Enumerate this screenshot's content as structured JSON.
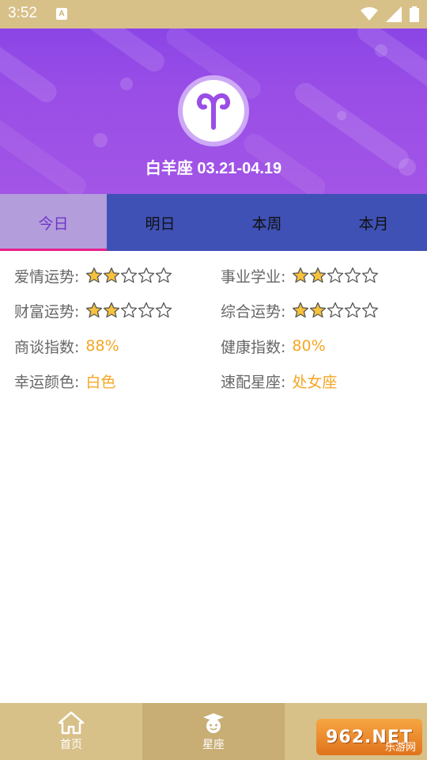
{
  "status_bar": {
    "time": "3:52",
    "a_badge": "A"
  },
  "header": {
    "sign_title": "白羊座 03.21-04.19"
  },
  "tabs": [
    {
      "label": "今日",
      "active": true
    },
    {
      "label": "明日",
      "active": false
    },
    {
      "label": "本周",
      "active": false
    },
    {
      "label": "本月",
      "active": false
    }
  ],
  "fortune": {
    "love": {
      "label": "爱情运势:",
      "stars_filled": 2,
      "stars_total": 5
    },
    "career": {
      "label": "事业学业:",
      "stars_filled": 2,
      "stars_total": 5
    },
    "wealth": {
      "label": "财富运势:",
      "stars_filled": 2,
      "stars_total": 5
    },
    "overall": {
      "label": "综合运势:",
      "stars_filled": 2,
      "stars_total": 5
    },
    "negotiation": {
      "label": "商谈指数:",
      "value": "88%"
    },
    "health": {
      "label": "健康指数:",
      "value": "80%"
    },
    "lucky_color": {
      "label": "幸运颜色:",
      "value": "白色"
    },
    "match_sign": {
      "label": "速配星座:",
      "value": "处女座"
    }
  },
  "bottom_nav": [
    {
      "label": "首页",
      "icon": "home-icon",
      "active": false
    },
    {
      "label": "星座",
      "icon": "scholar-avatar-icon",
      "active": true
    }
  ],
  "watermark": {
    "text": "962.NET",
    "sub": "乐游网"
  },
  "colors": {
    "accent_purple": "#9a4ee6",
    "tab_blue": "#3f51b5",
    "value_orange": "#f5a623",
    "nav_gold": "#d8c089"
  }
}
